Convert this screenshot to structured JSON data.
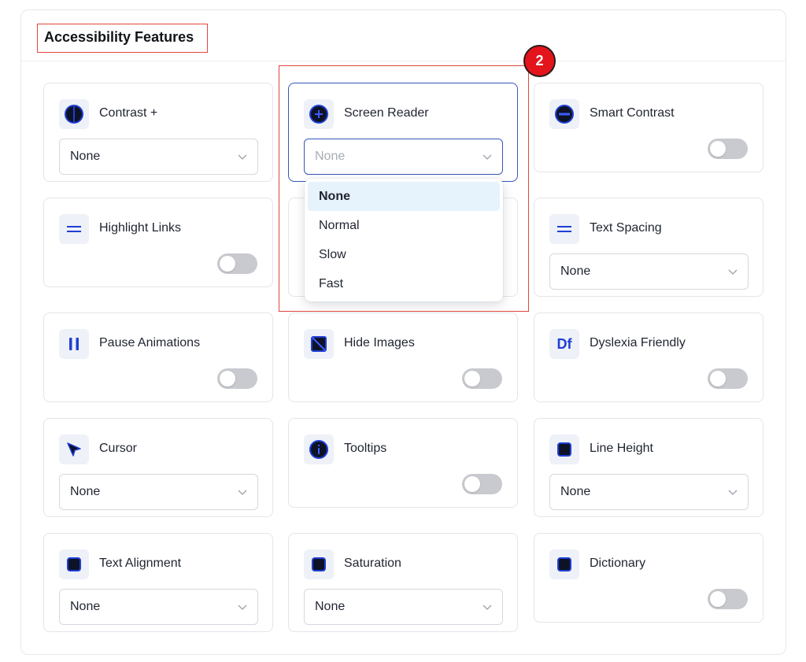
{
  "section": {
    "title": "Accessibility Features"
  },
  "badge": "2",
  "cards": [
    {
      "key": "contrast",
      "label": "Contrast +",
      "icon": "contrast-icon",
      "control": "select",
      "value": "None"
    },
    {
      "key": "screen-reader",
      "label": "Screen Reader",
      "icon": "plus-circle-icon",
      "control": "select",
      "value": "None",
      "open": true
    },
    {
      "key": "smart-contrast",
      "label": "Smart Contrast",
      "icon": "minus-circle-icon",
      "control": "toggle",
      "on": false
    },
    {
      "key": "highlight-links",
      "label": "Highlight Links",
      "icon": "equals-icon",
      "control": "toggle",
      "on": false
    },
    {
      "key": "text-spacing",
      "label": "Text Spacing",
      "icon": "equals-icon",
      "control": "select",
      "value": "None"
    },
    {
      "key": "pause-animations",
      "label": "Pause Animations",
      "icon": "pause-icon",
      "control": "toggle",
      "on": false
    },
    {
      "key": "hide-images",
      "label": "Hide Images",
      "icon": "image-off-icon",
      "control": "toggle",
      "on": false
    },
    {
      "key": "dyslexia-friendly",
      "label": "Dyslexia Friendly",
      "icon": "df-icon",
      "icon_text": "Df",
      "control": "toggle",
      "on": false
    },
    {
      "key": "cursor",
      "label": "Cursor",
      "icon": "cursor-icon",
      "control": "select",
      "value": "None"
    },
    {
      "key": "tooltips",
      "label": "Tooltips",
      "icon": "info-icon",
      "control": "toggle",
      "on": false
    },
    {
      "key": "line-height",
      "label": "Line Height",
      "icon": "square-icon",
      "control": "select",
      "value": "None"
    },
    {
      "key": "text-alignment",
      "label": "Text Alignment",
      "icon": "square-icon",
      "control": "select",
      "value": "None"
    },
    {
      "key": "saturation",
      "label": "Saturation",
      "icon": "square-icon",
      "control": "select",
      "value": "None"
    },
    {
      "key": "dictionary",
      "label": "Dictionary",
      "icon": "square-icon",
      "control": "toggle",
      "on": false
    }
  ],
  "dropdown": {
    "options": [
      "None",
      "Normal",
      "Slow",
      "Fast"
    ],
    "selected": "None"
  },
  "colors": {
    "accent": "#3656b8",
    "icon_blue": "#1f3fd6",
    "annotation_red": "#e0473d",
    "badge_red": "#e3141b",
    "toggle_off": "#c8cacf",
    "dropdown_selected_bg": "#e6f2fc"
  }
}
